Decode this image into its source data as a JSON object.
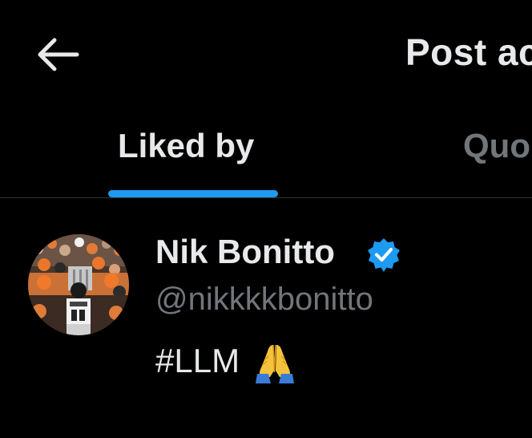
{
  "header": {
    "back_icon": "arrow-left-icon",
    "title": "Post ac"
  },
  "tabs": [
    {
      "label": "Liked by",
      "active": true
    },
    {
      "label": "Quo",
      "active": false
    }
  ],
  "colors": {
    "background": "#000000",
    "primary_text": "#e7e9ea",
    "secondary_text": "#71767b",
    "accent": "#1d9bf0",
    "divider": "#2f3336"
  },
  "users": [
    {
      "display_name": "Nik Bonitto",
      "verified": true,
      "verified_icon": "verified-badge-icon",
      "handle": "@nikkkkbonitto",
      "bio": "#LLM",
      "bio_emoji_icon": "folded-hands-icon",
      "avatar_icon": "avatar"
    }
  ]
}
